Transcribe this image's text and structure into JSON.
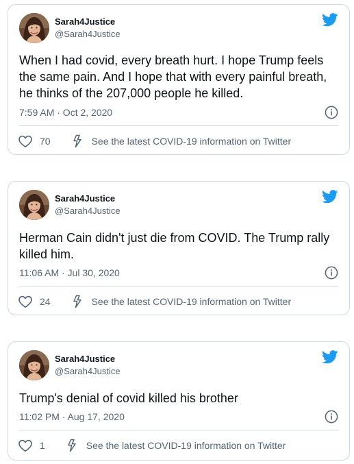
{
  "colors": {
    "twitter_blue": "#1d9bf0",
    "secondary_text": "#536471",
    "border": "#cfd9de"
  },
  "tweets": [
    {
      "display_name": "Sarah4Justice",
      "handle": "@Sarah4Justice",
      "text": "When I had covid, every breath hurt. I hope Trump feels the same pain. And I hope that with every painful breath, he thinks of the 207,000 people he killed.",
      "timestamp": "7:59 AM · Oct 2, 2020",
      "likes": "70",
      "covid_link": "See the latest COVID-19 information on Twitter"
    },
    {
      "display_name": "Sarah4Justice",
      "handle": "@Sarah4Justice",
      "text": "Herman Cain didn't just die from COVID. The Trump rally killed him.",
      "timestamp": "11:06 AM · Jul 30, 2020",
      "likes": "24",
      "covid_link": "See the latest COVID-19 information on Twitter"
    },
    {
      "display_name": "Sarah4Justice",
      "handle": "@Sarah4Justice",
      "text": "Trump's denial of covid killed his brother",
      "timestamp": "11:02 PM · Aug 17, 2020",
      "likes": "1",
      "covid_link": "See the latest COVID-19 information on Twitter"
    }
  ],
  "icons": {
    "bird": "twitter-bird-icon",
    "info": "info-icon",
    "like": "heart-icon",
    "covid": "lightning-icon"
  }
}
